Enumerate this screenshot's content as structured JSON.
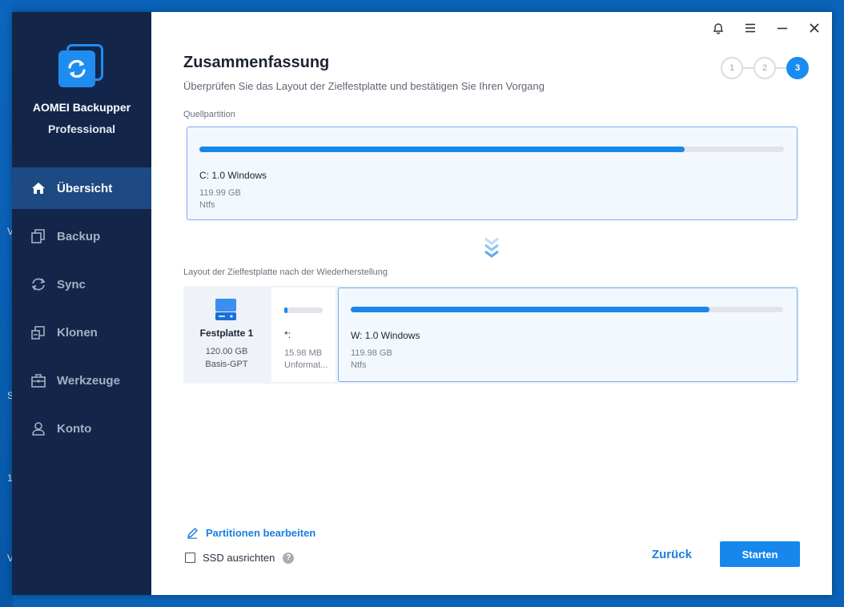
{
  "app": {
    "name": "AOMEI Backupper",
    "edition": "Professional"
  },
  "sidebar": {
    "items": [
      {
        "label": "Übersicht",
        "icon": "home-icon",
        "active": true
      },
      {
        "label": "Backup",
        "icon": "backup-icon",
        "active": false
      },
      {
        "label": "Sync",
        "icon": "sync-icon",
        "active": false
      },
      {
        "label": "Klonen",
        "icon": "clone-icon",
        "active": false
      },
      {
        "label": "Werkzeuge",
        "icon": "tools-icon",
        "active": false
      },
      {
        "label": "Konto",
        "icon": "account-icon",
        "active": false
      }
    ]
  },
  "window_controls": [
    "bell-icon",
    "menu-icon",
    "minimize-icon",
    "close-icon"
  ],
  "page": {
    "title": "Zusammenfassung",
    "subtitle": "Überprüfen Sie das Layout der Zielfestplatte und bestätigen Sie Ihren Vorgang",
    "steps": [
      "1",
      "2",
      "3"
    ],
    "current_step": "3"
  },
  "source": {
    "label": "Quellpartition",
    "partition": {
      "name": "C: 1.0 Windows",
      "size": "119.99 GB",
      "fs": "Ntfs",
      "used_fraction": 0.83
    }
  },
  "target": {
    "label": "Layout der Zielfestplatte nach der Wiederherstellung",
    "disk": {
      "name": "Festplatte 1",
      "size": "120.00 GB",
      "type": "Basis-GPT"
    },
    "unallocated": {
      "name": "*:",
      "size": "15.98 MB",
      "fs": "Unformat...",
      "used_fraction": 0.08
    },
    "partition": {
      "name": "W: 1.0 Windows",
      "size": "119.98 GB",
      "fs": "Ntfs",
      "used_fraction": 0.83
    }
  },
  "footer": {
    "edit_partitions": "Partitionen bearbeiten",
    "ssd_align": "SSD ausrichten",
    "ssd_align_checked": false,
    "help": "?",
    "back": "Zurück",
    "start": "Starten"
  },
  "colors": {
    "accent": "#1787ee",
    "sidebar": "#13264a",
    "sidebar_active": "#1e4a84"
  }
}
